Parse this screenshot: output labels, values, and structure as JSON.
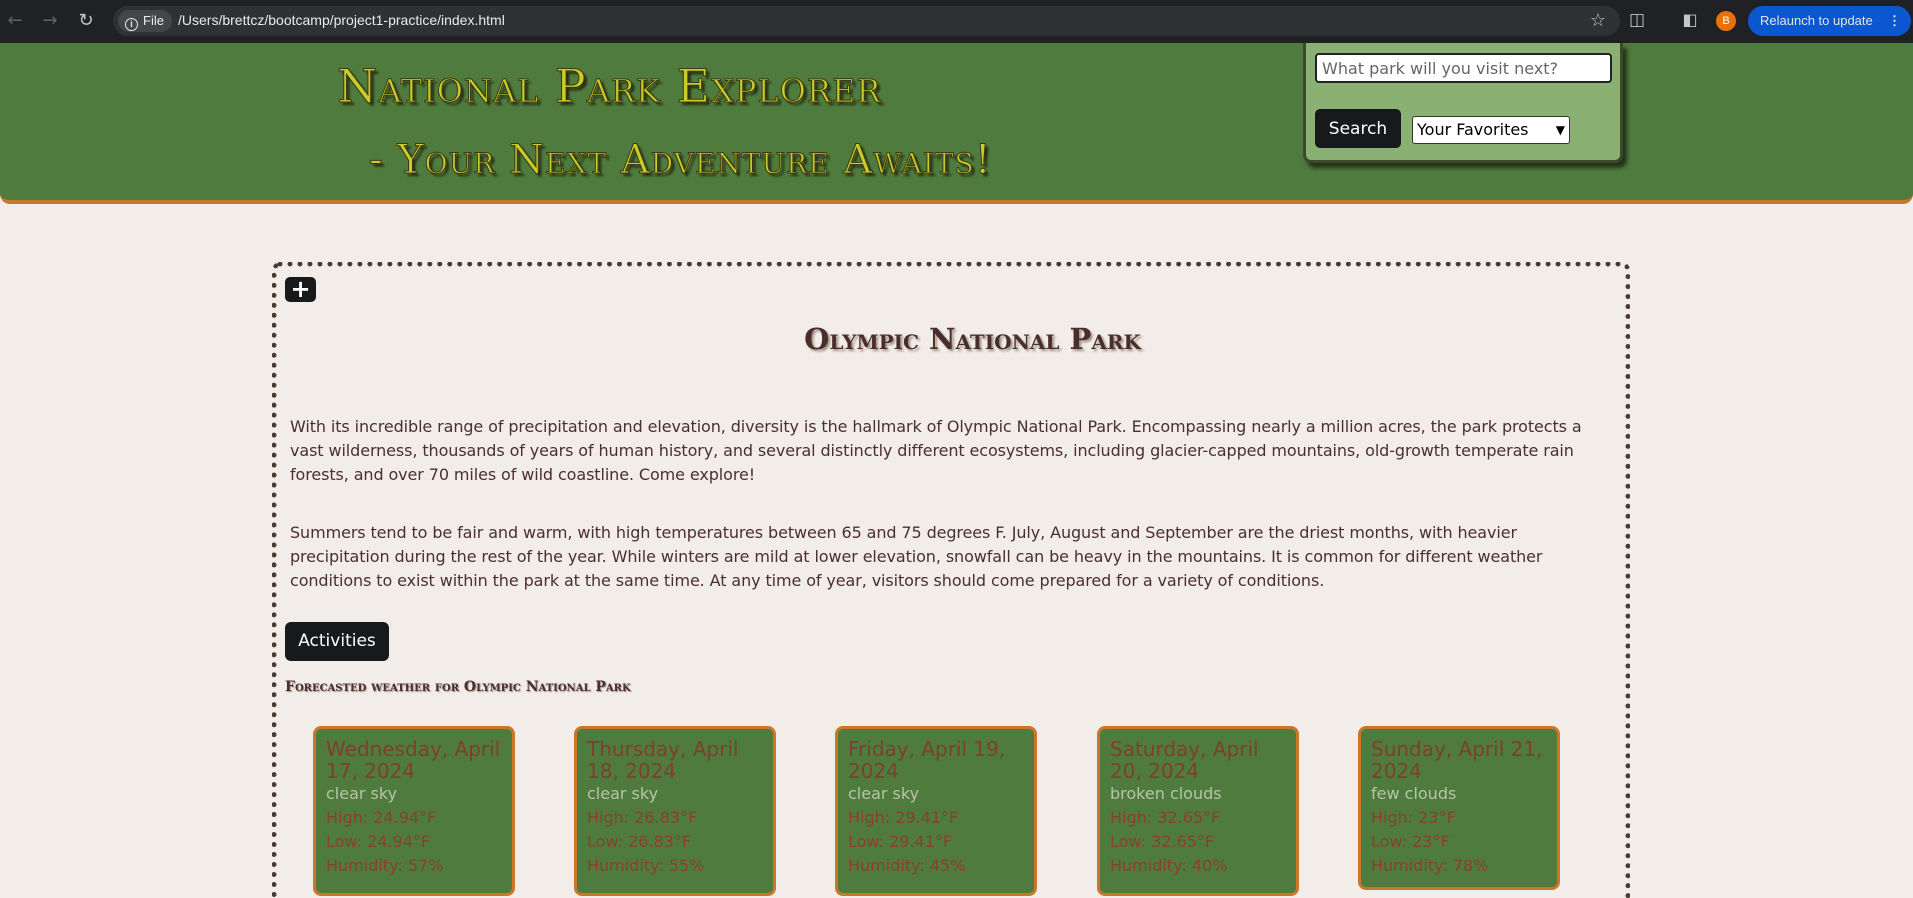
{
  "browser": {
    "file_chip": "File",
    "url": "/Users/brettcz/bootcamp/project1-practice/index.html",
    "profile_initial": "B",
    "relaunch_label": "Relaunch to update"
  },
  "header": {
    "title": "National Park Explorer",
    "subtitle": "- Your Next Adventure Awaits!",
    "search_placeholder": "What park will you visit next?",
    "search_button": "Search",
    "favorites_selected": "Your Favorites"
  },
  "park": {
    "add_favorite_symbol": "+",
    "name": "Olympic National Park",
    "description": "With its incredible range of precipitation and elevation, diversity is the hallmark of Olympic National Park. Encompassing nearly a million acres, the park protects a vast wilderness, thousands of years of human history, and several distinctly different ecosystems, including glacier-capped mountains, old-growth temperate rain forests, and over 70 miles of wild coastline. Come explore!",
    "weather_info": "Summers tend to be fair and warm, with high temperatures between 65 and 75 degrees F. July, August and September are the driest months, with heavier precipitation during the rest of the year. While winters are mild at lower elevation, snowfall can be heavy in the mountains. It is common for different weather conditions to exist within the park at the same time. At any time of year, visitors should come prepared for a variety of conditions.",
    "activities_button": "Activities",
    "forecast_heading": "Forecasted weather for Olympic National Park"
  },
  "forecast": [
    {
      "date": "Wednesday, April 17, 2024",
      "desc": "clear sky",
      "high": "High: 24.94°F",
      "low": "Low: 24.94°F",
      "humidity": "Humidity: 57%"
    },
    {
      "date": "Thursday, April 18, 2024",
      "desc": "clear sky",
      "high": "High: 26.83°F",
      "low": "Low: 26.83°F",
      "humidity": "Humidity: 55%"
    },
    {
      "date": "Friday, April 19, 2024",
      "desc": "clear sky",
      "high": "High: 29.41°F",
      "low": "Low: 29.41°F",
      "humidity": "Humidity: 45%"
    },
    {
      "date": "Saturday, April 20, 2024",
      "desc": "broken clouds",
      "high": "High: 32.65°F",
      "low": "Low: 32.65°F",
      "humidity": "Humidity: 40%"
    },
    {
      "date": "Sunday, April 21, 2024",
      "desc": "few clouds",
      "high": "High: 23°F",
      "low": "Low: 23°F",
      "humidity": "Humidity: 78%"
    }
  ],
  "colors": {
    "header_green": "#4f7c3e",
    "accent_orange": "#c9772b",
    "page_bg": "#f2ede8",
    "title_yellow": "#c9cc2a"
  }
}
